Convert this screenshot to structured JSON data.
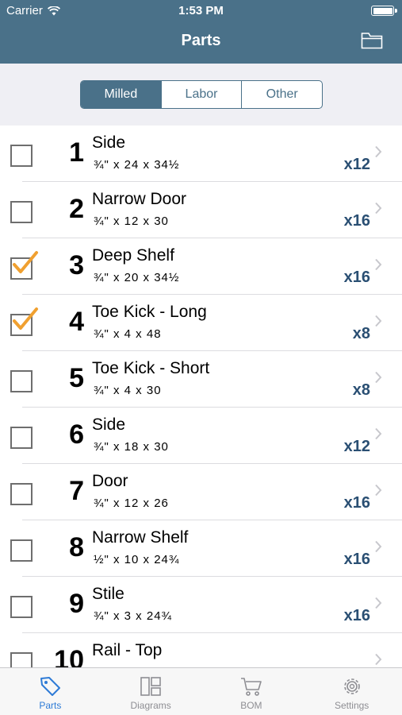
{
  "status": {
    "carrier": "Carrier",
    "time": "1:53 PM"
  },
  "nav": {
    "title": "Parts",
    "folder_icon": "folder-icon"
  },
  "segments": [
    "Milled",
    "Labor",
    "Other"
  ],
  "parts": [
    {
      "num": "1",
      "name": "Side",
      "dims": "¾\"  x  24  x  34½",
      "qty": "x12",
      "checked": false
    },
    {
      "num": "2",
      "name": "Narrow Door",
      "dims": "¾\"  x  12  x  30",
      "qty": "x16",
      "checked": false
    },
    {
      "num": "3",
      "name": "Deep Shelf",
      "dims": "¾\"  x  20  x  34½",
      "qty": "x16",
      "checked": true
    },
    {
      "num": "4",
      "name": "Toe Kick - Long",
      "dims": "¾\"  x  4  x  48",
      "qty": "x8",
      "checked": true
    },
    {
      "num": "5",
      "name": "Toe Kick - Short",
      "dims": "¾\"  x  4  x  30",
      "qty": "x8",
      "checked": false
    },
    {
      "num": "6",
      "name": "Side",
      "dims": "¾\"  x  18  x  30",
      "qty": "x12",
      "checked": false
    },
    {
      "num": "7",
      "name": "Door",
      "dims": "¾\"  x  12  x  26",
      "qty": "x16",
      "checked": false
    },
    {
      "num": "8",
      "name": "Narrow Shelf",
      "dims": "½\"  x  10  x  24¾",
      "qty": "x16",
      "checked": false
    },
    {
      "num": "9",
      "name": "Stile",
      "dims": "¾\"  x  3  x  24¾",
      "qty": "x16",
      "checked": false
    },
    {
      "num": "10",
      "name": "Rail - Top",
      "dims": "",
      "qty": "",
      "checked": false
    }
  ],
  "tabs": [
    {
      "label": "Parts",
      "icon": "tag-icon",
      "active": true
    },
    {
      "label": "Diagrams",
      "icon": "diagrams-icon",
      "active": false
    },
    {
      "label": "BOM",
      "icon": "cart-icon",
      "active": false
    },
    {
      "label": "Settings",
      "icon": "gear-icon",
      "active": false
    }
  ],
  "colors": {
    "nav": "#4a7189",
    "accent": "#2a4f73",
    "check": "#f0a030",
    "tab_active": "#2e7bd6"
  }
}
